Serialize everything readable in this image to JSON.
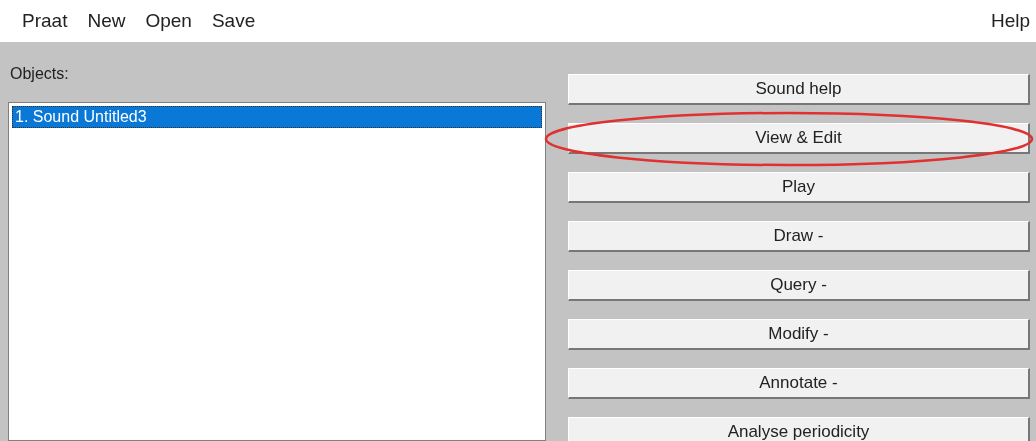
{
  "menu_bar": {
    "items": [
      "Praat",
      "New",
      "Open",
      "Save"
    ],
    "help": "Help"
  },
  "objects": {
    "label": "Objects:",
    "items": [
      {
        "label": "1. Sound Untitled3",
        "selected": true
      }
    ]
  },
  "buttons": [
    {
      "label": "Sound help",
      "circled": false
    },
    {
      "label": "View & Edit",
      "circled": true
    },
    {
      "label": "Play",
      "circled": false
    },
    {
      "label": "Draw -",
      "circled": false
    },
    {
      "label": "Query -",
      "circled": false
    },
    {
      "label": "Modify -",
      "circled": false
    },
    {
      "label": "Annotate -",
      "circled": false
    },
    {
      "label": "Analyse periodicity",
      "circled": false
    }
  ]
}
